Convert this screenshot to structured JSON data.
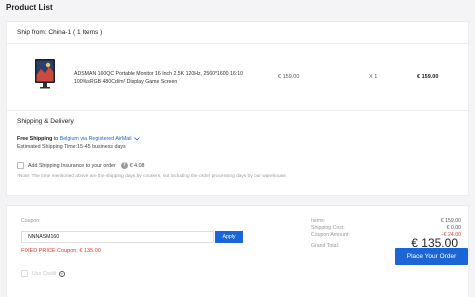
{
  "page": {
    "title": "Product List"
  },
  "shipment": {
    "ship_from": "Ship from: China-1 ( 1 Items )",
    "product": {
      "name": "ADSMAN 160QC Portable Monitor 16 Inch 2.5K 120Hz, 2560*1600 16:10 100%sRGB 480Cd/m² Display Game Screen",
      "unit_price": "€ 159.00",
      "quantity": "X 1",
      "line_total": "€ 159.00",
      "thumbnail_icon": "portable-monitor-image"
    }
  },
  "delivery": {
    "title": "Shipping & Delivery",
    "free_shipping_label": "Free Shipping",
    "to_text": " to ",
    "destination": "Belgium",
    "via_text": " via ",
    "method": "Registered AirMail",
    "estimated": "Estimated Shipping Time:15-45 business days",
    "insurance_label": "Add Shipping Insurance to your order",
    "insurance_price": "€ 4.08",
    "note": "*Note: The time mentioned above are the shipping days by couriers, not including the order processing days by our warehouse."
  },
  "coupon": {
    "label": "Coupon:",
    "value": "NNNASM160",
    "apply_label": "Apply",
    "fixed_price": "FIXED PRICE Coupon: € 135.00",
    "use_credit_label": "Use Credit"
  },
  "summary": {
    "items_label": "Items:",
    "items_value": "€ 159.00",
    "shipping_label": "Shipping Cost:",
    "shipping_value": "€ 0.00",
    "coupon_label": "Coupon Amount:",
    "coupon_value": "-€ 24.00",
    "grand_label": "Grand Total:",
    "grand_value": "€ 135.00",
    "place_order_label": "Place Your Order"
  },
  "colors": {
    "accent": "#1a66d6",
    "discount": "#e03a2f"
  }
}
